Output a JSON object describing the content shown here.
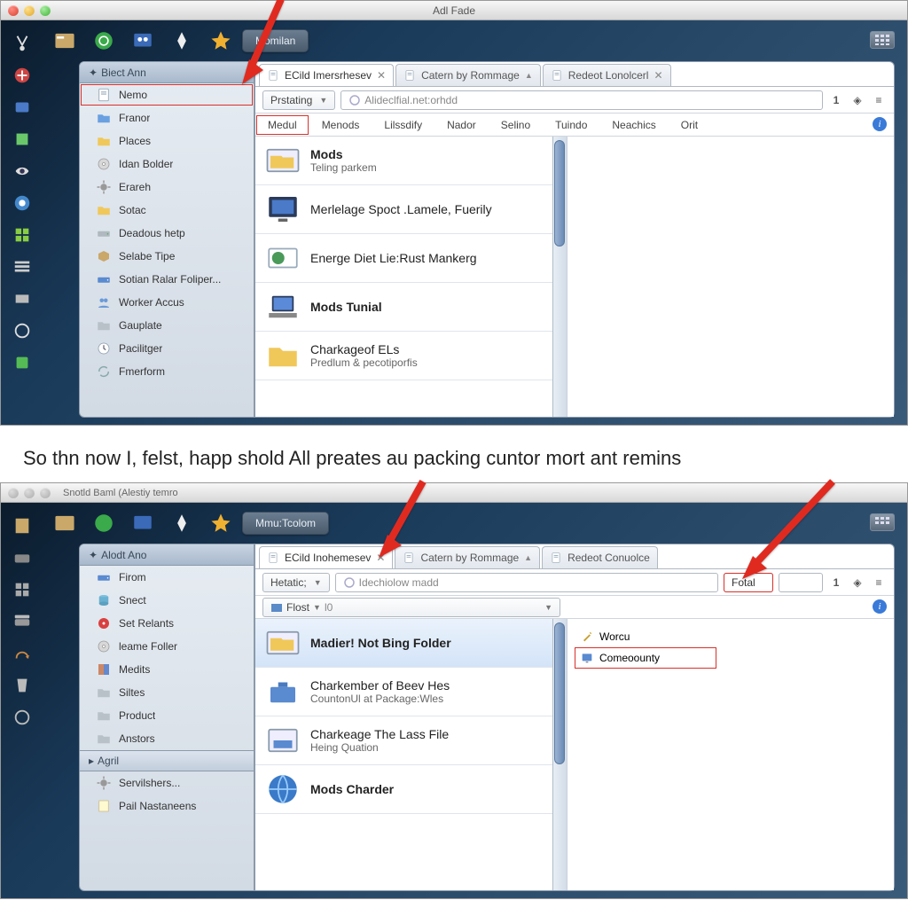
{
  "shot1": {
    "window_title": "Adl Fade",
    "pill": "Momilan",
    "sidebar": {
      "header": "Biect Ann",
      "items": [
        {
          "label": "Nemo",
          "icon": "page",
          "boxed": true
        },
        {
          "label": "Franor",
          "icon": "folder-blue"
        },
        {
          "label": "Places",
          "icon": "folder-yellow"
        },
        {
          "label": "Idan Bolder",
          "icon": "disc"
        },
        {
          "label": "Erareh",
          "icon": "gear"
        },
        {
          "label": "Sotac",
          "icon": "folder-yellow"
        },
        {
          "label": "Deadous hetp",
          "icon": "drive"
        },
        {
          "label": "Selabe Tipe",
          "icon": "box"
        },
        {
          "label": "Sotian Ralar Foliper...",
          "icon": "drive-blue"
        },
        {
          "label": "Worker Accus",
          "icon": "users"
        },
        {
          "label": "Gauplate",
          "icon": "folder-grey"
        },
        {
          "label": "Pacilitger",
          "icon": "clock"
        },
        {
          "label": "Fmerform",
          "icon": "sync"
        }
      ]
    },
    "tabs": [
      {
        "label": "ECild Imersrhesev",
        "active": true,
        "close": true
      },
      {
        "label": "Catern by Rommage",
        "active": false,
        "opts": true
      },
      {
        "label": "Redeot Lonolcerl",
        "active": false,
        "close": true
      }
    ],
    "addr": {
      "dropdown": "Prstating",
      "field": "Alideclfial.net:orhdd",
      "num": "1"
    },
    "menus": [
      "Medul",
      "Menods",
      "Lilssdify",
      "Nador",
      "Selino",
      "Tuindo",
      "Neachics",
      "Orit"
    ],
    "menu_boxed_index": 0,
    "list": [
      {
        "t1": "Mods",
        "t2": "Teling parkem",
        "b": true,
        "icon": "folder-window"
      },
      {
        "t1": "Merlelage Spoct .Lamele, Fuerily",
        "icon": "monitor"
      },
      {
        "t1": "Energe Diet Lie:Rust Mankerg",
        "icon": "globe-card"
      },
      {
        "t1": "Mods Tunial",
        "b": true,
        "icon": "laptop"
      },
      {
        "t1": "Charkageof ELs",
        "t2": "Predlum & pecotiporfis",
        "icon": "folder-yellow"
      }
    ]
  },
  "caption": "So thn now I, felst, happ shold All preates au packing cuntor mort ant remins",
  "shot2": {
    "window_title": "Snotld Baml (Alestiy temro",
    "pill": "Mmu:Tcolom",
    "sidebar": {
      "header": "Alodt Ano",
      "items": [
        {
          "label": "Firom",
          "icon": "drive-blue"
        },
        {
          "label": "Snect",
          "icon": "cylinder"
        },
        {
          "label": "Set Relants",
          "icon": "disc-red"
        },
        {
          "label": "leame Foller",
          "icon": "disc"
        },
        {
          "label": "Medits",
          "icon": "swatch"
        },
        {
          "label": "Siltes",
          "icon": "folder-grey"
        },
        {
          "label": "Product",
          "icon": "folder-grey"
        },
        {
          "label": "Anstors",
          "icon": "folder-grey"
        }
      ],
      "header2": "Agril",
      "items2": [
        {
          "label": "Servilshers...",
          "icon": "gear"
        },
        {
          "label": "Pail Nastaneens",
          "icon": "note"
        }
      ]
    },
    "tabs": [
      {
        "label": "ECild Inohemesev",
        "active": true,
        "close": true
      },
      {
        "label": "Catern by Rommage",
        "active": false,
        "opts": true
      },
      {
        "label": "Redeot Conuolce",
        "active": false
      }
    ],
    "addr": {
      "dropdown": "Hetatic;",
      "field": "Idechiolow madd",
      "field2": "Fotal",
      "num": "1"
    },
    "filter": {
      "label": "Flost",
      "sub": "l0"
    },
    "side": [
      {
        "label": "Worcu",
        "icon": "wizard"
      },
      {
        "label": "Comeoounty",
        "icon": "screen",
        "boxed": true
      }
    ],
    "list": [
      {
        "t1": "Madier! Not Bing Folder",
        "b": true,
        "icon": "folder-window",
        "sel": true
      },
      {
        "t1": "Charkember of Beev Hes",
        "t2": "CountonUl at Package:Wles",
        "icon": "briefcase"
      },
      {
        "t1": "Charkeage The Lass File",
        "t2": "Heing Quation",
        "icon": "drive-window"
      },
      {
        "t1": "Mods Charder",
        "b": true,
        "icon": "globe"
      }
    ]
  }
}
